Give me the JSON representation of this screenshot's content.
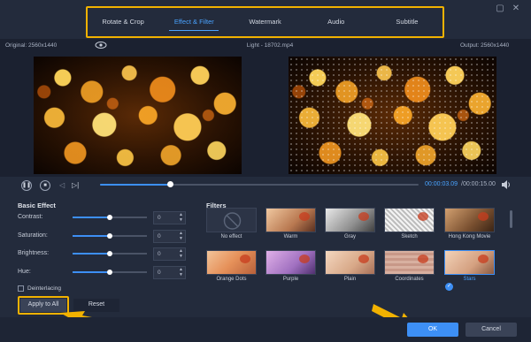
{
  "tabs": [
    {
      "label": "Rotate & Crop"
    },
    {
      "label": "Effect & Filter"
    },
    {
      "label": "Watermark"
    },
    {
      "label": "Audio"
    },
    {
      "label": "Subtitle"
    }
  ],
  "active_tab": "Effect & Filter",
  "preview": {
    "original_label": "Original: 2560x1440",
    "file_name": "Light - 18702.mp4",
    "output_label": "Output: 2560x1440"
  },
  "playback": {
    "current_time": "00:00:03.09",
    "total_time": "/00:00:15.00",
    "progress": 0.22
  },
  "basic_effect": {
    "title": "Basic Effect",
    "rows": [
      {
        "label": "Contrast:",
        "value": "0",
        "level": 0.5
      },
      {
        "label": "Saturation:",
        "value": "0",
        "level": 0.5
      },
      {
        "label": "Brightness:",
        "value": "0",
        "level": 0.5
      },
      {
        "label": "Hue:",
        "value": "0",
        "level": 0.5
      }
    ],
    "deinterlacing_label": "Deinterlacing",
    "apply_all_label": "Apply to All",
    "reset_label": "Reset"
  },
  "filters": {
    "title": "Filters",
    "items": [
      {
        "label": "No effect"
      },
      {
        "label": "Warm"
      },
      {
        "label": "Gray"
      },
      {
        "label": "Sketch"
      },
      {
        "label": "Hong Kong Movie"
      },
      {
        "label": "Orange Dots"
      },
      {
        "label": "Purple"
      },
      {
        "label": "Plain"
      },
      {
        "label": "Coordinates"
      },
      {
        "label": "Stars"
      }
    ],
    "selected": "Stars"
  },
  "footer": {
    "ok_label": "OK",
    "cancel_label": "Cancel"
  },
  "colors": {
    "accent": "#3d8ff5",
    "highlight": "#f2b200",
    "background": "#232b3c"
  }
}
